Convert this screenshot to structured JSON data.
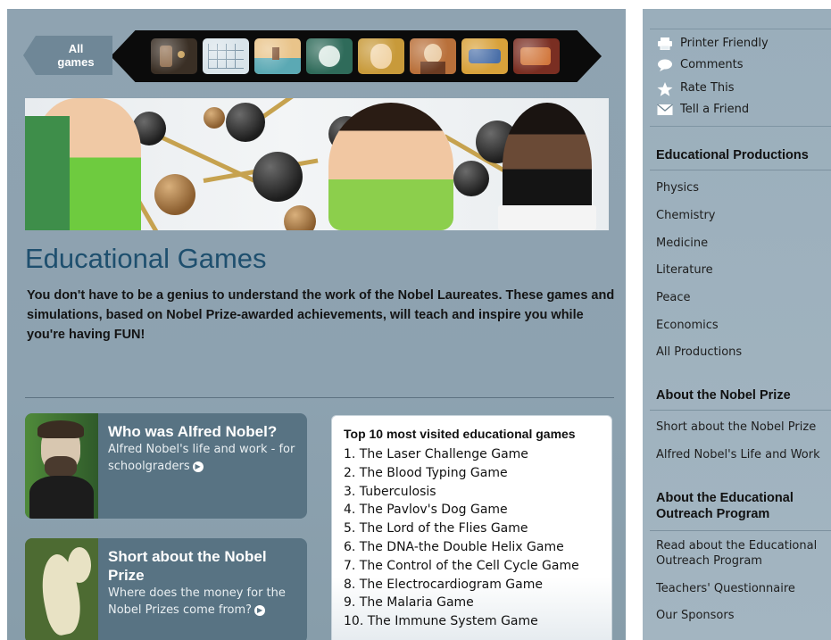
{
  "games_bar": {
    "all_games_label_line1": "All",
    "all_games_label_line2": "games",
    "thumbnails": [
      {
        "icon": "game-thumbnail-1",
        "color": "#3a2f25"
      },
      {
        "icon": "game-thumbnail-2",
        "color": "#d9e4ea"
      },
      {
        "icon": "game-thumbnail-3",
        "color": "#e9c48a"
      },
      {
        "icon": "game-thumbnail-4",
        "color": "#2f6b5a"
      },
      {
        "icon": "game-thumbnail-5",
        "color": "#c89a3a"
      },
      {
        "icon": "game-thumbnail-6",
        "color": "#b9703a"
      },
      {
        "icon": "game-thumbnail-7",
        "color": "#d8a13a"
      },
      {
        "icon": "game-thumbnail-8",
        "color": "#7a2e22"
      }
    ]
  },
  "main": {
    "title": "Educational Games",
    "intro": "You don't have to be a genius to understand the work of the Nobel Laureates. These games and simulations, based on Nobel Prize-awarded achievements, will teach and inspire you while you're having FUN!",
    "cards": [
      {
        "heading": "Who was Alfred Nobel?",
        "body": "Alfred Nobel's life and work - for schoolgraders"
      },
      {
        "heading": "Short about the Nobel Prize",
        "body": "Where does the money for the Nobel Prizes come from?"
      }
    ],
    "top10": {
      "heading": "Top 10 most visited educational games",
      "items": [
        "1. The Laser Challenge Game",
        "2. The Blood Typing Game",
        "3. Tuberculosis",
        "4. The Pavlov's Dog Game",
        "5. The Lord of the Flies Game",
        "6. The DNA-the Double Helix Game",
        "7. The Control of the Cell Cycle Game",
        "8. The Electrocardiogram Game",
        "9. The Malaria Game",
        "10. The Immune System Game"
      ]
    }
  },
  "sidebar": {
    "tools": [
      {
        "label": "Printer Friendly",
        "icon": "printer-icon"
      },
      {
        "label": "Comments",
        "icon": "speech-bubble-icon"
      },
      {
        "label": "Rate This",
        "icon": "star-icon"
      },
      {
        "label": "Tell a Friend",
        "icon": "envelope-icon"
      }
    ],
    "section1": {
      "title": "Educational Productions",
      "links": [
        "Physics",
        "Chemistry",
        "Medicine",
        "Literature",
        "Peace",
        "Economics",
        "All Productions"
      ]
    },
    "section2": {
      "title": "About the Nobel Prize",
      "links": [
        "Short about the Nobel Prize",
        "Alfred Nobel's Life and Work"
      ]
    },
    "section3": {
      "title": "About the Educational Outreach Program",
      "links": [
        "Read about the Educational Outreach Program",
        "Teachers' Questionnaire",
        "Our Sponsors"
      ]
    }
  },
  "colors": {
    "panel_bg": "#8fa3b1",
    "title_blue": "#1e4f6e",
    "card_bg": "#587383",
    "sidebar_bg": "#9aaebb"
  }
}
